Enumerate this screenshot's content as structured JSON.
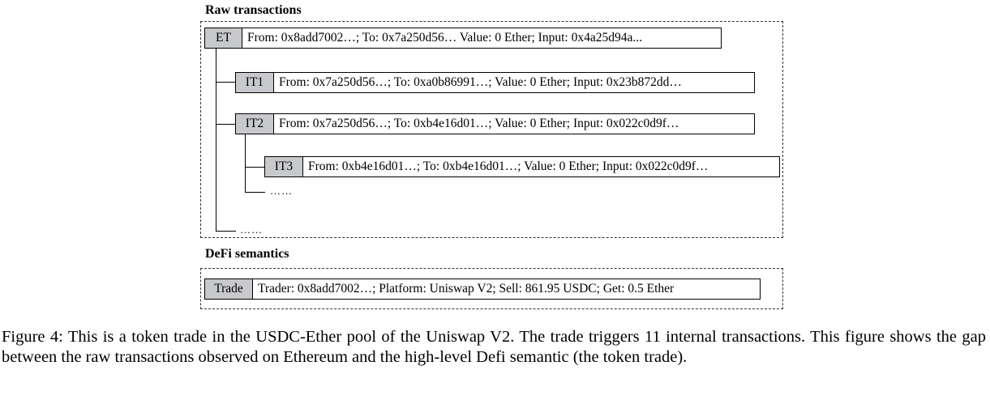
{
  "raw_section": {
    "title": "Raw transactions",
    "ET": {
      "tag": "ET",
      "text": "From: 0x8add7002…; To: 0x7a250d56… Value: 0 Ether; Input: 0x4a25d94a..."
    },
    "IT1": {
      "tag": "IT1",
      "text": "From: 0x7a250d56…; To: 0xa0b86991…; Value: 0 Ether; Input: 0x23b872dd…"
    },
    "IT2": {
      "tag": "IT2",
      "text": "From: 0x7a250d56…; To: 0xb4e16d01…; Value: 0 Ether; Input: 0x022c0d9f…"
    },
    "IT3": {
      "tag": "IT3",
      "text": "From: 0xb4e16d01…; To: 0xb4e16d01…; Value: 0 Ether; Input: 0x022c0d9f…"
    },
    "ellipsis_inner": "……",
    "ellipsis_outer": "……"
  },
  "defi_section": {
    "title": "DeFi semantics",
    "trade": {
      "tag": "Trade",
      "text": "Trader: 0x8add7002…; Platform: Uniswap V2; Sell: 861.95 USDC; Get: 0.5 Ether"
    }
  },
  "caption": {
    "text": "Figure 4: This is a token trade in the USDC-Ether pool of the Uniswap V2. The trade triggers 11 internal transactions. This figure shows the gap between the raw transactions observed on Ethereum and the high-level Defi semantic (the token trade)."
  }
}
